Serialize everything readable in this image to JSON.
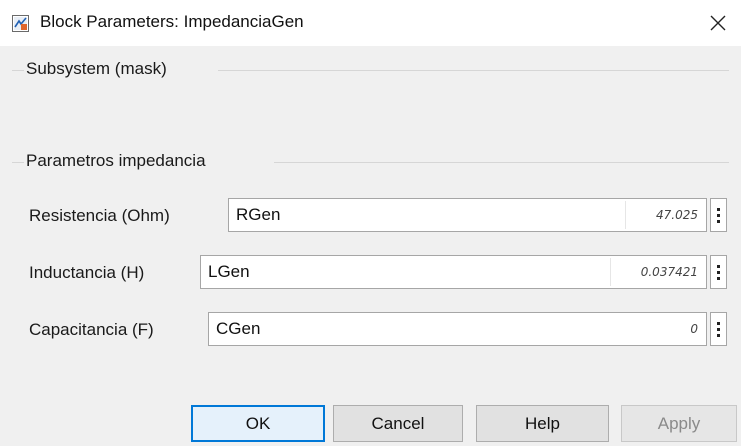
{
  "window": {
    "title": "Block Parameters: ImpedanciaGen",
    "icon": "simulink-block-icon",
    "close_icon": "close-icon"
  },
  "groups": {
    "subsystem": {
      "label": "Subsystem (mask)"
    },
    "params": {
      "label": "Parametros impedancia"
    }
  },
  "parameters": [
    {
      "label": "Resistencia (Ohm)",
      "value": "RGen",
      "evaluated": "47.025"
    },
    {
      "label": "Inductancia (H)",
      "value": "LGen",
      "evaluated": "0.037421"
    },
    {
      "label": "Capacitancia (F)",
      "value": "CGen",
      "evaluated": "0"
    }
  ],
  "buttons": {
    "ok": "OK",
    "cancel": "Cancel",
    "help": "Help",
    "apply": "Apply"
  },
  "colors": {
    "default_button_border": "#0078d7",
    "background": "#f0f0f0"
  }
}
